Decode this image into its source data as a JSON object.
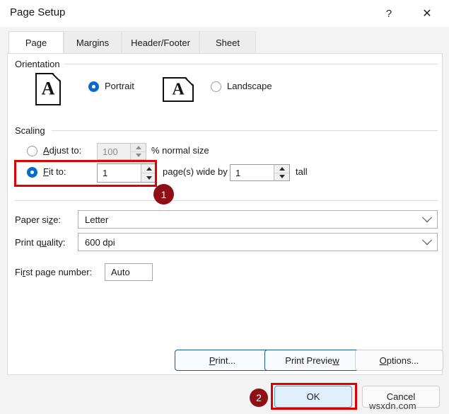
{
  "window": {
    "title": "Page Setup",
    "help_icon": "?",
    "close_icon": "✕"
  },
  "tabs": [
    {
      "label": "Page",
      "active": true
    },
    {
      "label": "Margins",
      "active": false
    },
    {
      "label": "Header/Footer",
      "active": false
    },
    {
      "label": "Sheet",
      "active": false
    }
  ],
  "orientation": {
    "group_label": "Orientation",
    "portrait": {
      "label": "Portrait",
      "selected": true,
      "icon": "portrait-page-icon",
      "glyph": "A"
    },
    "landscape": {
      "label": "Landscape",
      "selected": false,
      "icon": "landscape-page-icon",
      "glyph": "A"
    }
  },
  "scaling": {
    "group_label": "Scaling",
    "adjust": {
      "label": "Adjust to:",
      "value": "100",
      "suffix": "% normal size",
      "selected": false,
      "disabled": true
    },
    "fit": {
      "label": "Fit to:",
      "wide_value": "1",
      "middle_text": "page(s) wide by",
      "tall_value": "1",
      "suffix": "tall",
      "selected": true
    }
  },
  "paper": {
    "paper_size_label": "Paper size:",
    "paper_size_value": "Letter",
    "print_quality_label": "Print quality:",
    "print_quality_value": "600 dpi"
  },
  "first_page": {
    "label": "First page number:",
    "value": "Auto"
  },
  "action_buttons": {
    "print": "Print...",
    "print_preview": "Print Preview",
    "options": "Options..."
  },
  "footer_buttons": {
    "ok": "OK",
    "cancel": "Cancel"
  },
  "annotations": {
    "badge_one": "1",
    "badge_two": "2",
    "highlight_color": "#e00000",
    "badge_color": "#8f0f14"
  },
  "watermark": "wsxdn.com"
}
